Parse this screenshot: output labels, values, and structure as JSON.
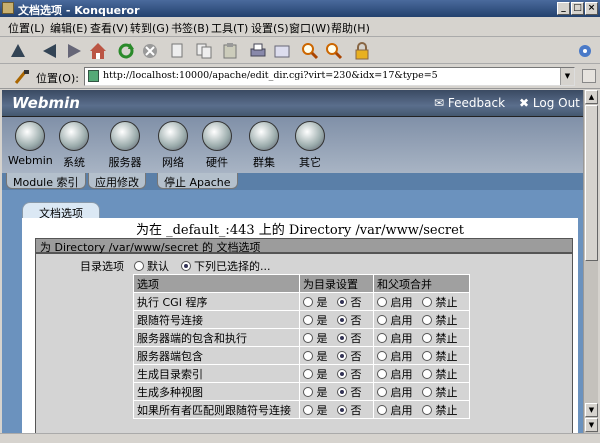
{
  "window": {
    "title": "文档选项 - Konqueror"
  },
  "menu": [
    "位置(L)",
    "编辑(E)",
    "查看(V)",
    "转到(G)",
    "书签(B)",
    "工具(T)",
    "设置(S)",
    "窗口(W)",
    "帮助(H)"
  ],
  "toolbar_icons": [
    "up-icon",
    "back-icon",
    "forward-icon",
    "home-icon",
    "reload-icon",
    "stop-icon",
    "cut-icon",
    "copy-icon",
    "paste-icon",
    "print-icon",
    "security-icon",
    "zoom-in-icon",
    "zoom-out-icon",
    "lock-icon",
    "settings-icon"
  ],
  "location": {
    "label": "位置(O):",
    "url": "http://localhost:10000/apache/edit_dir.cgi?virt=230&idx=17&type=5"
  },
  "webmin": {
    "logo": "Webmin",
    "feedback": "Feedback",
    "logout": "Log Out",
    "categories": [
      "Webmin",
      "系统",
      "服务器",
      "网络",
      "硬件",
      "群集",
      "其它"
    ],
    "subtabs": [
      "Module 索引",
      "应用修改",
      "停止 Apache"
    ],
    "tab": "文档选项",
    "page_title": "为在 _default_:443 上的 Directory /var/www/secret",
    "section_header": "为 Directory /var/www/secret 的 文档选项",
    "dir_label": "目录选项",
    "dir_default": "默认",
    "dir_selected": "下列已选择的...",
    "headers": [
      "选项",
      "为目录设置",
      "和父项合并"
    ],
    "yes": "是",
    "no": "否",
    "enable": "启用",
    "disable": "禁止",
    "options": [
      "执行 CGI 程序",
      "跟随符号连接",
      "服务器端的包含和执行",
      "服务器端包含",
      "生成目录索引",
      "生成多种视图",
      "如果所有者匹配则跟随符号连接"
    ]
  }
}
